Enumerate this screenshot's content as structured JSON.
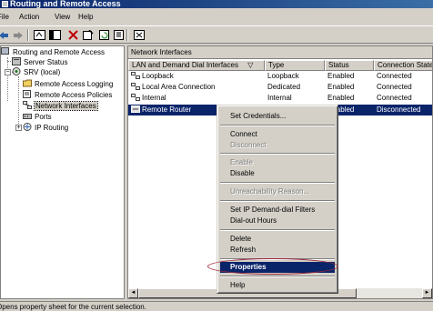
{
  "window": {
    "title": "Routing and Remote Access"
  },
  "menu": [
    {
      "label": "File"
    },
    {
      "label": "Action"
    },
    {
      "label": "View"
    },
    {
      "label": "Help"
    }
  ],
  "toolbar": {
    "icons": [
      "back-arrow-icon",
      "forward-arrow-icon",
      "up-folder-icon",
      "show-tree-icon",
      "delete-x-icon",
      "properties-icon",
      "refresh-icon",
      "export-icon",
      "help-icon"
    ]
  },
  "tree": {
    "items": [
      {
        "label": "Routing and Remote Access"
      },
      {
        "label": "Server Status"
      },
      {
        "label": "SRV (local)"
      },
      {
        "label": "Remote Access Logging"
      },
      {
        "label": "Remote Access Policies"
      },
      {
        "label": "Network Interfaces"
      },
      {
        "label": "Ports"
      },
      {
        "label": "IP Routing"
      }
    ]
  },
  "pane": {
    "title": "Network Interfaces",
    "columns": [
      "LAN and Demand Dial Interfaces",
      "Type",
      "Status",
      "Connection State"
    ],
    "sort_indicator": "▽",
    "rows": [
      {
        "name": "Loopback",
        "type": "Loopback",
        "status": "Enabled",
        "state": "Connected"
      },
      {
        "name": "Local Area Connection",
        "type": "Dedicated",
        "status": "Enabled",
        "state": "Connected"
      },
      {
        "name": "Internal",
        "type": "Internal",
        "status": "Enabled",
        "state": "Connected"
      },
      {
        "name": "Remote Router",
        "type": "",
        "status": "Enabled",
        "state": "Disconnected"
      }
    ]
  },
  "context_menu": {
    "items": [
      {
        "label": "Set Credentials...",
        "enabled": true
      },
      {
        "label": "Connect",
        "enabled": true
      },
      {
        "label": "Disconnect",
        "enabled": false
      },
      {
        "label": "Enable",
        "enabled": false
      },
      {
        "label": "Disable",
        "enabled": true
      },
      {
        "label": "Unreachability Reason...",
        "enabled": false
      },
      {
        "label": "Set IP Demand-dial Filters",
        "enabled": true
      },
      {
        "label": "Dial-out Hours",
        "enabled": true
      },
      {
        "label": "Delete",
        "enabled": true
      },
      {
        "label": "Refresh",
        "enabled": true
      },
      {
        "label": "Properties",
        "enabled": true,
        "highlighted": true
      },
      {
        "label": "Help",
        "enabled": true
      }
    ]
  },
  "statusbar": {
    "text": "Opens property sheet for the current selection."
  },
  "colors": {
    "selection": "#0a246a",
    "face": "#d4d0c8",
    "annotation_oval": "#9a2a3a"
  }
}
